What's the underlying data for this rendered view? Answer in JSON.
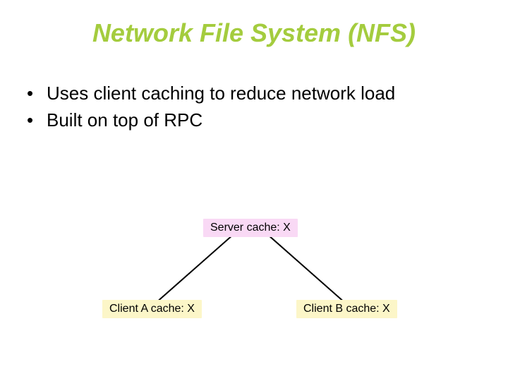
{
  "title": "Network File System (NFS)",
  "bullets": [
    "Uses client caching to reduce network load",
    "Built on top of RPC"
  ],
  "diagram": {
    "server": "Server cache:  X",
    "client_a": "Client A cache: X",
    "client_b": "Client B cache: X"
  },
  "colors": {
    "title": "#a4cc3e",
    "server_bg": "#f9d9f5",
    "client_bg": "#fcf6c8"
  }
}
